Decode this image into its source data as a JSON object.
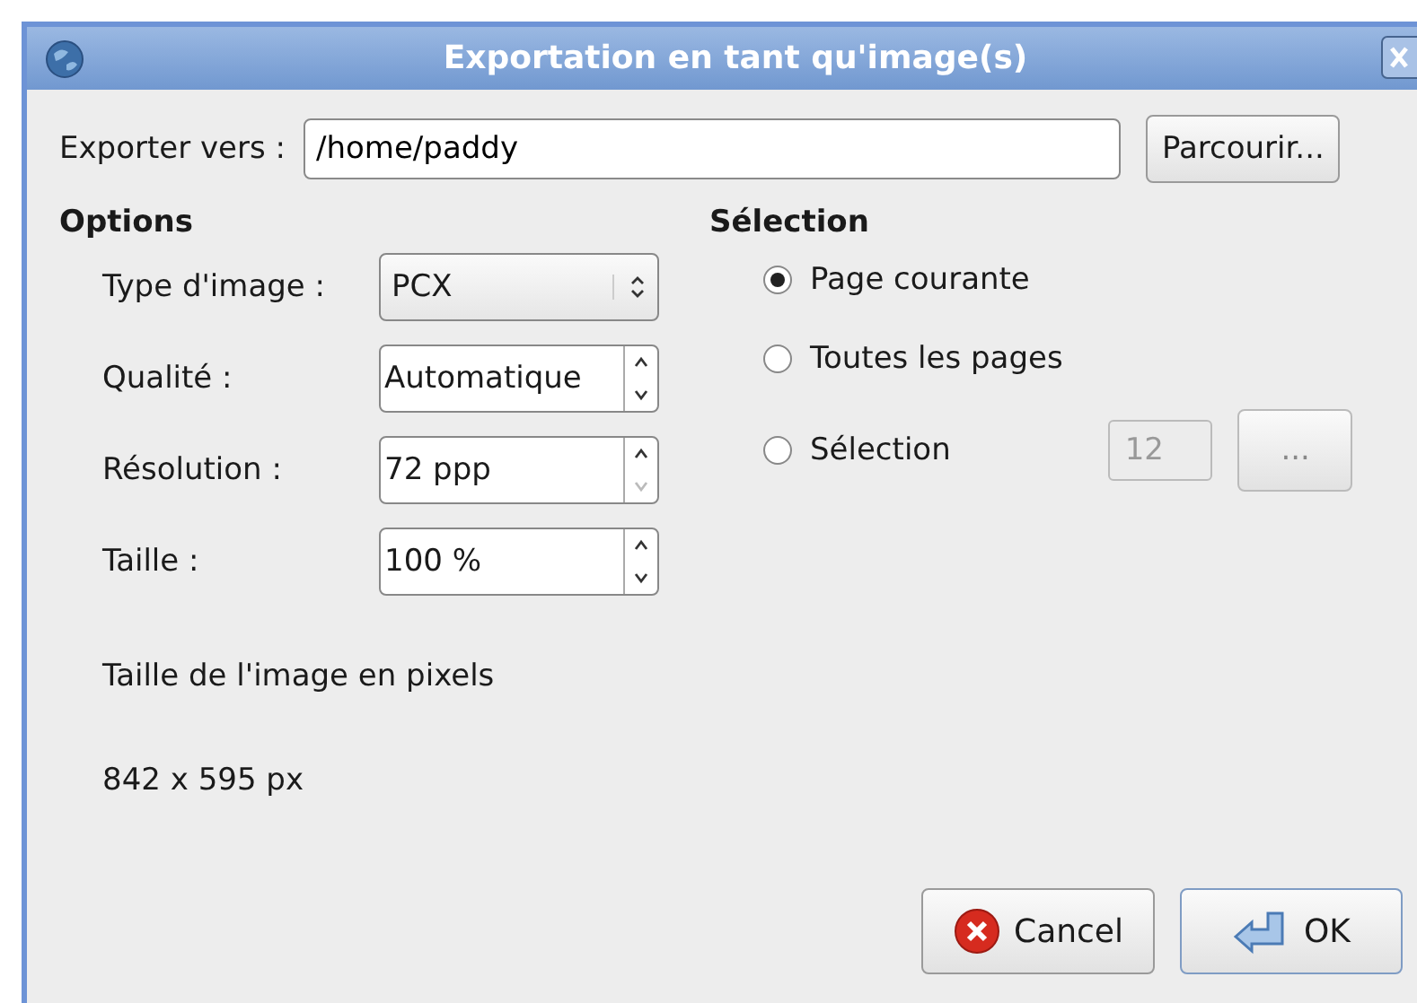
{
  "window": {
    "title": "Exportation en tant qu'image(s)"
  },
  "export_to": {
    "label": "Exporter vers :",
    "value": "/home/paddy",
    "browse_button": "Parcourir..."
  },
  "options": {
    "heading": "Options",
    "fields": [
      {
        "kind": "combo",
        "label": "Type d'image :",
        "value": "PCX"
      },
      {
        "kind": "spin",
        "label": "Qualité :",
        "value": "Automatique",
        "up_disabled": false,
        "down_disabled": false
      },
      {
        "kind": "spin",
        "label": "Résolution :",
        "value": "72 ppp",
        "up_disabled": false,
        "down_disabled": true
      },
      {
        "kind": "spin",
        "label": "Taille :",
        "value": "100 %",
        "up_disabled": false,
        "down_disabled": false
      }
    ],
    "size_caption": "Taille de l'image en pixels",
    "size_value": "842 x 595 px"
  },
  "selection": {
    "heading": "Sélection",
    "radios": [
      {
        "label": "Page courante",
        "selected": true
      },
      {
        "label": "Toutes les pages",
        "selected": false
      },
      {
        "label": "Sélection",
        "selected": false
      }
    ],
    "range_field": {
      "value": "12",
      "disabled": true
    },
    "range_button": {
      "label": "...",
      "disabled": true
    }
  },
  "buttons": [
    {
      "kind": "cancel",
      "label": "Cancel"
    },
    {
      "kind": "ok",
      "label": "OK"
    }
  ]
}
